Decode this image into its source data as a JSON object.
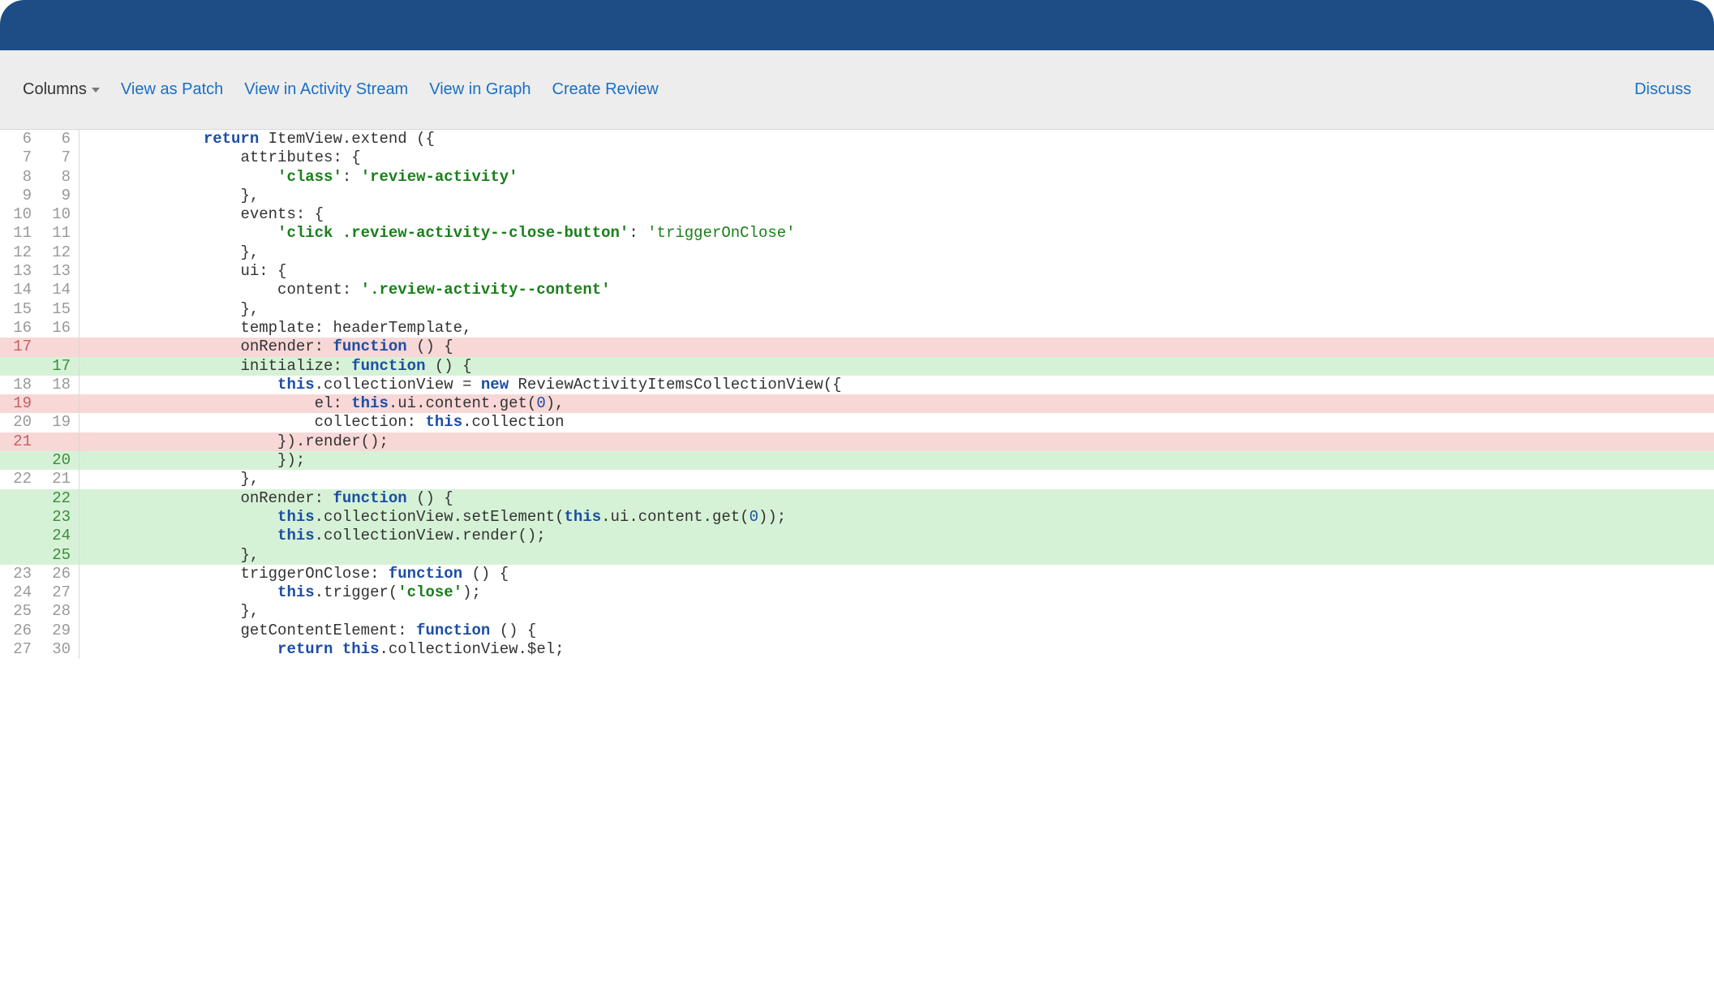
{
  "toolbar": {
    "columns_label": "Columns",
    "view_as_patch": "View as Patch",
    "view_in_activity": "View in Activity Stream",
    "view_in_graph": "View in Graph",
    "create_review": "Create Review",
    "discuss": "Discuss"
  },
  "diff": {
    "lines": [
      {
        "old": "6",
        "new": "6",
        "type": "ctx",
        "indent": 3,
        "segments": [
          {
            "t": "kw",
            "v": "return"
          },
          {
            "t": "p",
            "v": " ItemView.extend ({"
          }
        ]
      },
      {
        "old": "7",
        "new": "7",
        "type": "ctx",
        "indent": 4,
        "segments": [
          {
            "t": "p",
            "v": "attributes: {"
          }
        ]
      },
      {
        "old": "8",
        "new": "8",
        "type": "ctx",
        "indent": 5,
        "segments": [
          {
            "t": "strb",
            "v": "'class'"
          },
          {
            "t": "p",
            "v": ": "
          },
          {
            "t": "strb",
            "v": "'review-activity'"
          }
        ]
      },
      {
        "old": "9",
        "new": "9",
        "type": "ctx",
        "indent": 4,
        "segments": [
          {
            "t": "p",
            "v": "},"
          }
        ]
      },
      {
        "old": "10",
        "new": "10",
        "type": "ctx",
        "indent": 4,
        "segments": [
          {
            "t": "p",
            "v": "events: {"
          }
        ]
      },
      {
        "old": "11",
        "new": "11",
        "type": "ctx",
        "indent": 5,
        "segments": [
          {
            "t": "strb",
            "v": "'click .review-activity--close-button'"
          },
          {
            "t": "p",
            "v": ": "
          },
          {
            "t": "str",
            "v": "'triggerOnClose'"
          }
        ]
      },
      {
        "old": "12",
        "new": "12",
        "type": "ctx",
        "indent": 4,
        "segments": [
          {
            "t": "p",
            "v": "},"
          }
        ]
      },
      {
        "old": "13",
        "new": "13",
        "type": "ctx",
        "indent": 4,
        "segments": [
          {
            "t": "p",
            "v": "ui: {"
          }
        ]
      },
      {
        "old": "14",
        "new": "14",
        "type": "ctx",
        "indent": 5,
        "segments": [
          {
            "t": "p",
            "v": "content: "
          },
          {
            "t": "strb",
            "v": "'.review-activity--content'"
          }
        ]
      },
      {
        "old": "15",
        "new": "15",
        "type": "ctx",
        "indent": 4,
        "segments": [
          {
            "t": "p",
            "v": "},"
          }
        ]
      },
      {
        "old": "16",
        "new": "16",
        "type": "ctx",
        "indent": 4,
        "segments": [
          {
            "t": "p",
            "v": "template: headerTemplate,"
          }
        ]
      },
      {
        "old": "17",
        "new": "",
        "type": "del",
        "indent": 4,
        "segments": [
          {
            "t": "p",
            "v": "onRender: "
          },
          {
            "t": "kw",
            "v": "function"
          },
          {
            "t": "p",
            "v": " () {"
          }
        ]
      },
      {
        "old": "",
        "new": "17",
        "type": "add",
        "indent": 4,
        "segments": [
          {
            "t": "p",
            "v": "initialize: "
          },
          {
            "t": "kw",
            "v": "function"
          },
          {
            "t": "p",
            "v": " () {"
          }
        ]
      },
      {
        "old": "18",
        "new": "18",
        "type": "ctx",
        "indent": 5,
        "segments": [
          {
            "t": "kw",
            "v": "this"
          },
          {
            "t": "p",
            "v": ".collectionView = "
          },
          {
            "t": "kw",
            "v": "new"
          },
          {
            "t": "p",
            "v": " ReviewActivityItemsCollectionView({"
          }
        ]
      },
      {
        "old": "19",
        "new": "",
        "type": "del",
        "indent": 6,
        "segments": [
          {
            "t": "p",
            "v": "el: "
          },
          {
            "t": "kw",
            "v": "this"
          },
          {
            "t": "p",
            "v": ".ui.content.get("
          },
          {
            "t": "num",
            "v": "0"
          },
          {
            "t": "p",
            "v": "),"
          }
        ]
      },
      {
        "old": "20",
        "new": "19",
        "type": "ctx",
        "indent": 6,
        "segments": [
          {
            "t": "p",
            "v": "collection: "
          },
          {
            "t": "kw",
            "v": "this"
          },
          {
            "t": "p",
            "v": ".collection"
          }
        ]
      },
      {
        "old": "21",
        "new": "",
        "type": "del",
        "indent": 5,
        "segments": [
          {
            "t": "p",
            "v": "}).render();"
          }
        ]
      },
      {
        "old": "",
        "new": "20",
        "type": "add",
        "indent": 5,
        "segments": [
          {
            "t": "p",
            "v": "});"
          }
        ]
      },
      {
        "old": "22",
        "new": "21",
        "type": "ctx",
        "indent": 4,
        "segments": [
          {
            "t": "p",
            "v": "},"
          }
        ]
      },
      {
        "old": "",
        "new": "22",
        "type": "add",
        "indent": 4,
        "segments": [
          {
            "t": "p",
            "v": "onRender: "
          },
          {
            "t": "kw",
            "v": "function"
          },
          {
            "t": "p",
            "v": " () {"
          }
        ]
      },
      {
        "old": "",
        "new": "23",
        "type": "add",
        "indent": 5,
        "segments": [
          {
            "t": "kw",
            "v": "this"
          },
          {
            "t": "p",
            "v": ".collectionView.setElement("
          },
          {
            "t": "kw",
            "v": "this"
          },
          {
            "t": "p",
            "v": ".ui.content.get("
          },
          {
            "t": "num",
            "v": "0"
          },
          {
            "t": "p",
            "v": "));"
          }
        ]
      },
      {
        "old": "",
        "new": "24",
        "type": "add",
        "indent": 5,
        "segments": [
          {
            "t": "kw",
            "v": "this"
          },
          {
            "t": "p",
            "v": ".collectionView.render();"
          }
        ]
      },
      {
        "old": "",
        "new": "25",
        "type": "add",
        "indent": 4,
        "segments": [
          {
            "t": "p",
            "v": "},"
          }
        ]
      },
      {
        "old": "23",
        "new": "26",
        "type": "ctx",
        "indent": 4,
        "segments": [
          {
            "t": "p",
            "v": "triggerOnClose: "
          },
          {
            "t": "kw",
            "v": "function"
          },
          {
            "t": "p",
            "v": " () {"
          }
        ]
      },
      {
        "old": "24",
        "new": "27",
        "type": "ctx",
        "indent": 5,
        "segments": [
          {
            "t": "kw",
            "v": "this"
          },
          {
            "t": "p",
            "v": ".trigger("
          },
          {
            "t": "strb",
            "v": "'close'"
          },
          {
            "t": "p",
            "v": ");"
          }
        ]
      },
      {
        "old": "25",
        "new": "28",
        "type": "ctx",
        "indent": 4,
        "segments": [
          {
            "t": "p",
            "v": "},"
          }
        ]
      },
      {
        "old": "26",
        "new": "29",
        "type": "ctx",
        "indent": 4,
        "segments": [
          {
            "t": "p",
            "v": "getContentElement: "
          },
          {
            "t": "kw",
            "v": "function"
          },
          {
            "t": "p",
            "v": " () {"
          }
        ]
      },
      {
        "old": "27",
        "new": "30",
        "type": "ctx",
        "indent": 5,
        "segments": [
          {
            "t": "kw",
            "v": "return"
          },
          {
            "t": "p",
            "v": " "
          },
          {
            "t": "kw",
            "v": "this"
          },
          {
            "t": "p",
            "v": ".collectionView.$el;"
          }
        ]
      }
    ]
  }
}
